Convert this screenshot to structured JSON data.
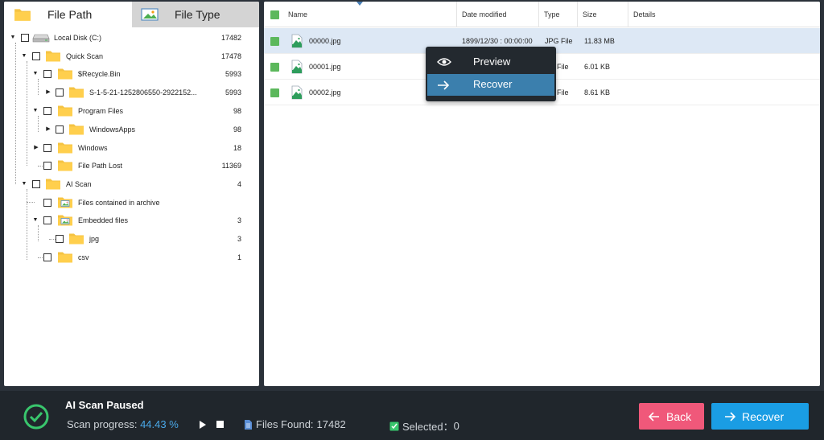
{
  "tabs": [
    {
      "label": "File Path",
      "icon": "folder-icon"
    },
    {
      "label": "File Type",
      "icon": "image-icon"
    }
  ],
  "tree": [
    {
      "label": "Local Disk (C:)",
      "count": "17482",
      "icon": "drive-icon"
    },
    {
      "label": "Quick Scan",
      "count": "17478",
      "icon": "folder-icon"
    },
    {
      "label": "$Recycle.Bin",
      "count": "5993",
      "icon": "folder-icon"
    },
    {
      "label": "S-1-5-21-1252806550-2922152...",
      "count": "5993",
      "icon": "folder-icon"
    },
    {
      "label": "Program Files",
      "count": "98",
      "icon": "folder-icon"
    },
    {
      "label": "WindowsApps",
      "count": "98",
      "icon": "folder-icon"
    },
    {
      "label": "Windows",
      "count": "18",
      "icon": "folder-icon"
    },
    {
      "label": "File Path Lost",
      "count": "11369",
      "icon": "folder-icon"
    },
    {
      "label": "AI Scan",
      "count": "4",
      "icon": "folder-icon"
    },
    {
      "label": "Files contained in archive",
      "count": "",
      "icon": "folder-image-icon"
    },
    {
      "label": "Embedded files",
      "count": "3",
      "icon": "folder-image-icon"
    },
    {
      "label": "jpg",
      "count": "3",
      "icon": "folder-icon"
    },
    {
      "label": "csv",
      "count": "1",
      "icon": "folder-icon"
    }
  ],
  "columns": {
    "name": "Name",
    "date": "Date modified",
    "type": "Type",
    "size": "Size",
    "details": "Details"
  },
  "files": [
    {
      "name": "00000.jpg",
      "date": "1899/12/30 : 00:00:00",
      "type": "JPG File",
      "size": "11.83 MB",
      "selected": true
    },
    {
      "name": "00001.jpg",
      "date": "",
      "type": "JPG File",
      "type_visible": "File",
      "size": "6.01 KB",
      "selected": false
    },
    {
      "name": "00002.jpg",
      "date": "",
      "type": "JPG File",
      "type_visible": "File",
      "size": "8.61 KB",
      "selected": false
    }
  ],
  "context_menu": {
    "preview": "Preview",
    "recover": "Recover"
  },
  "status": {
    "title": "AI Scan Paused",
    "progress_label": "Scan progress:",
    "progress_value": "44.43 %",
    "files_found_label": "Files Found:",
    "files_found_value": "17482",
    "selected_label": "Selected：",
    "selected_value": "0"
  },
  "buttons": {
    "back": "Back",
    "recover": "Recover"
  },
  "colors": {
    "accent_blue": "#1a9de4",
    "back_pink": "#f0587a",
    "folder_yellow": "#f5c342",
    "check_green": "#5cb85c",
    "status_green": "#39c66d"
  }
}
